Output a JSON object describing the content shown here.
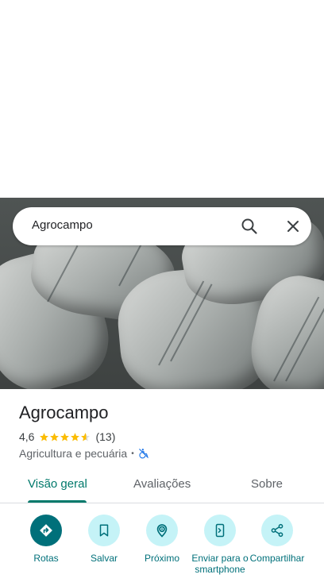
{
  "search": {
    "query": "Agrocampo"
  },
  "place": {
    "name": "Agrocampo",
    "rating": "4,6",
    "rating_value": 4.6,
    "review_count": "(13)",
    "category": "Agricultura e pecuária",
    "separator": "•",
    "accessibility_icon": "not-wheelchair-accessible-icon"
  },
  "tabs": [
    {
      "label": "Visão geral",
      "active": true
    },
    {
      "label": "Avaliações",
      "active": false
    },
    {
      "label": "Sobre",
      "active": false
    }
  ],
  "actions": [
    {
      "label": "Rotas",
      "icon": "directions-icon",
      "primary": true
    },
    {
      "label": "Salvar",
      "icon": "bookmark-icon",
      "primary": false
    },
    {
      "label": "Próximo",
      "icon": "nearby-icon",
      "primary": false
    },
    {
      "label": "Enviar para o smartphone",
      "icon": "send-to-phone-icon",
      "primary": false
    },
    {
      "label": "Compartilhar",
      "icon": "share-icon",
      "primary": false
    }
  ],
  "colors": {
    "accent": "#00796b",
    "action_bg": "#c5f3f7",
    "action_primary_bg": "#00707a",
    "star": "#fbbc04"
  }
}
